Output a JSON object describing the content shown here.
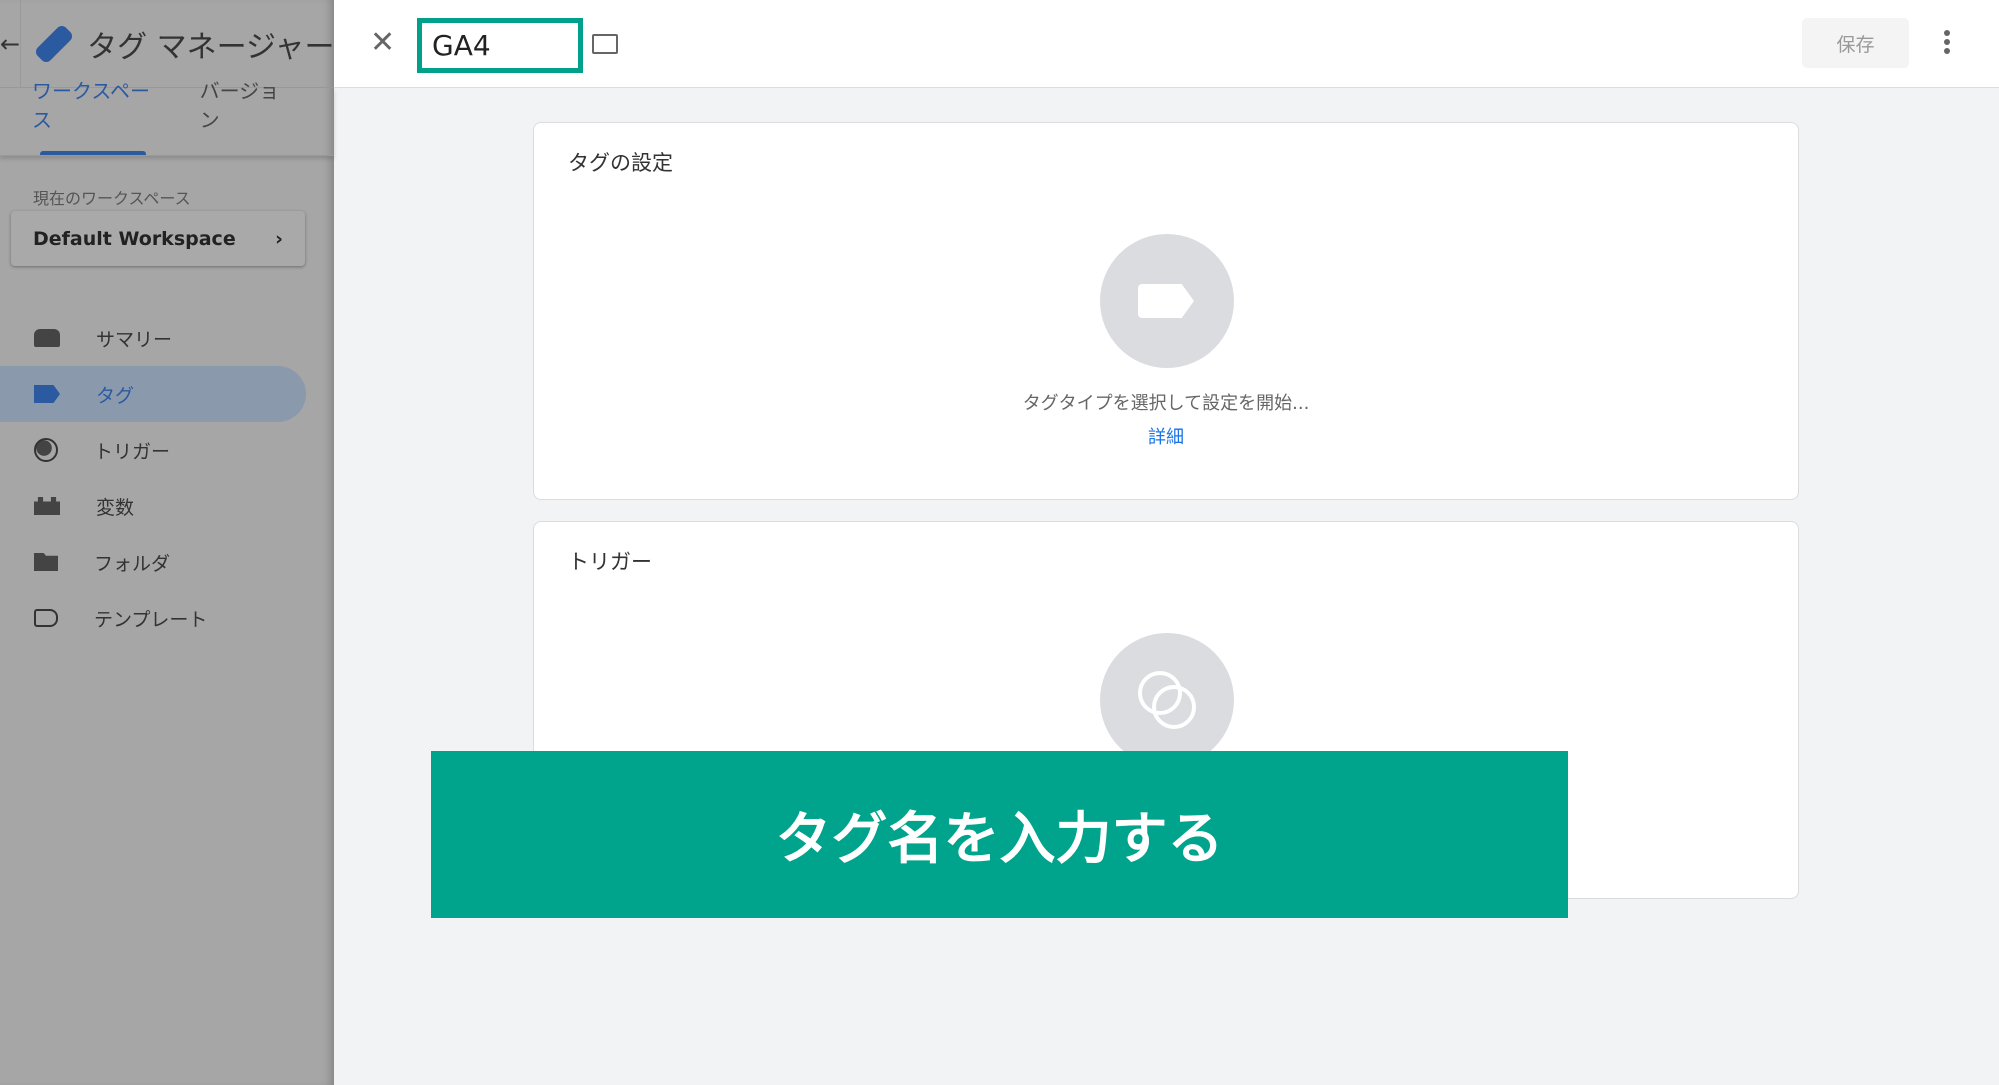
{
  "sidebar": {
    "title": "タグ マネージャー",
    "tabs": [
      "ワークスペース",
      "バージョン"
    ],
    "workspace_label": "現在のワークスペース",
    "workspace": "Default Workspace",
    "items": [
      {
        "label": "サマリー",
        "icon": "summary-icon"
      },
      {
        "label": "タグ",
        "icon": "tag-icon",
        "active": true
      },
      {
        "label": "トリガー",
        "icon": "trigger-icon"
      },
      {
        "label": "変数",
        "icon": "variables-icon"
      },
      {
        "label": "フォルダ",
        "icon": "folder-icon"
      },
      {
        "label": "テンプレート",
        "icon": "template-icon"
      }
    ]
  },
  "editor": {
    "tag_name": "GA4",
    "save_label": "保存",
    "tag_config": {
      "title": "タグの設定",
      "hint": "タグタイプを選択して設定を開始...",
      "link": "詳細"
    },
    "trigger": {
      "title": "トリガー"
    }
  },
  "banner": {
    "text": "タグ名を入力する",
    "color": "#00a38b"
  },
  "colors": {
    "accent": "#2c5aa0",
    "highlight": "#00a08a"
  }
}
